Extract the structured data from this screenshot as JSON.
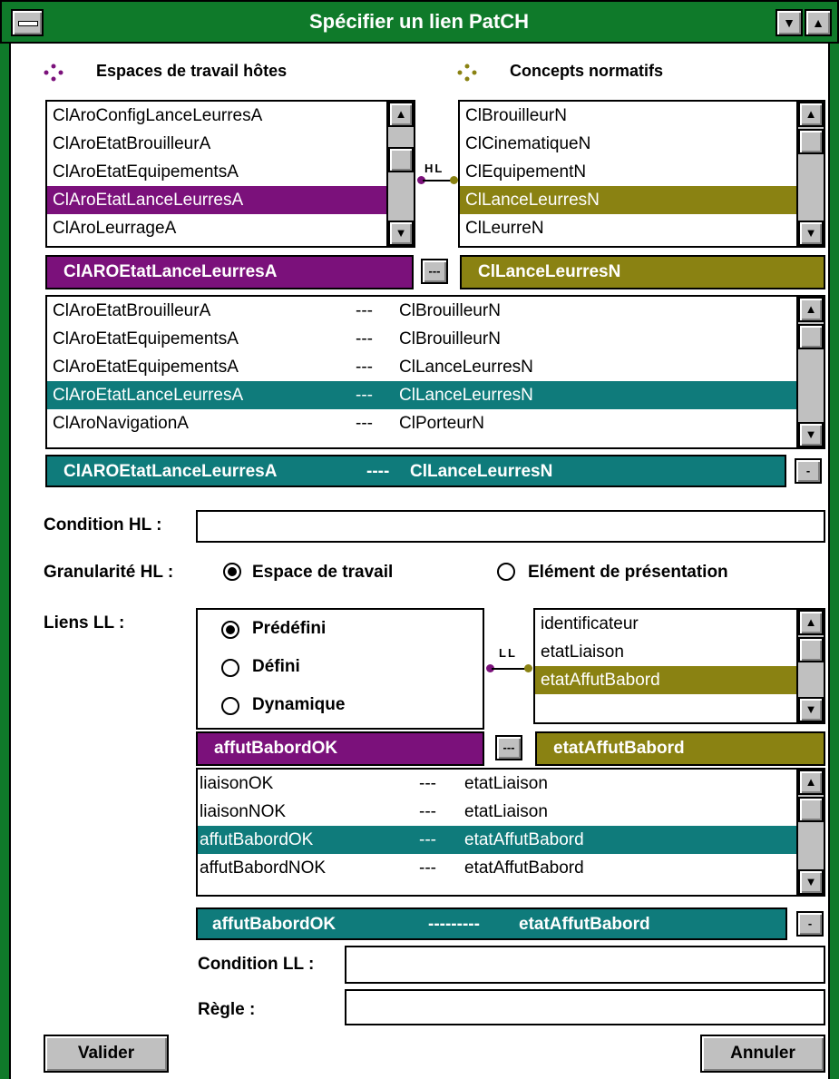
{
  "window": {
    "title": "Spécifier un lien PatCH"
  },
  "colors": {
    "purple": "#7b117b",
    "olive": "#8a8212",
    "teal": "#0f7b7b",
    "frame": "#0f7a2a"
  },
  "headers": {
    "host": "Espaces de travail hôtes",
    "normative": "Concepts normatifs"
  },
  "host_list": [
    "ClAroConfigLanceLeurresA",
    "ClAroEtatBrouilleurA",
    "ClAroEtatEquipementsA",
    "ClAroEtatLanceLeurresA",
    "ClAroLeurrageA"
  ],
  "normative_list": [
    "ClBrouilleurN",
    "ClCinematiqueN",
    "ClEquipementN",
    "ClLanceLeurresN",
    "ClLeurreN"
  ],
  "hl_tag": "HL",
  "ll_tag": "LL",
  "host_selected": "ClAROEtatLanceLeurresA",
  "normative_selected": "ClLanceLeurresN",
  "link_button": "---",
  "remove_button": "-",
  "hl_links": [
    [
      "ClAroEtatBrouilleurA",
      "---",
      "ClBrouilleurN"
    ],
    [
      "ClAroEtatEquipementsA",
      "---",
      "ClBrouilleurN"
    ],
    [
      "ClAroEtatEquipementsA",
      "---",
      "ClLanceLeurresN"
    ],
    [
      "ClAroEtatLanceLeurresA",
      "---",
      "ClLanceLeurresN"
    ],
    [
      "ClAroNavigationA",
      "---",
      "ClPorteurN"
    ]
  ],
  "hl_selected": {
    "left": "ClAROEtatLanceLeurresA",
    "sep": "----",
    "right": "ClLanceLeurresN"
  },
  "condition_hl": {
    "label": "Condition HL :",
    "value": ""
  },
  "granularite": {
    "label": "Granularité HL :",
    "opt1": "Espace de travail",
    "opt2": "Elément de présentation"
  },
  "liens_ll": {
    "label": "Liens LL :",
    "opt1": "Prédéfini",
    "opt2": "Défini",
    "opt3": "Dynamique"
  },
  "attr_list": [
    "identificateur",
    "etatLiaison",
    "etatAffutBabord"
  ],
  "ll_left_selected": "affutBabordOK",
  "ll_right_selected": "etatAffutBabord",
  "ll_links": [
    [
      "liaisonOK",
      "---",
      "etatLiaison"
    ],
    [
      "liaisonNOK",
      "---",
      "etatLiaison"
    ],
    [
      "affutBabordOK",
      "---",
      "etatAffutBabord"
    ],
    [
      "affutBabordNOK",
      "---",
      "etatAffutBabord"
    ]
  ],
  "ll_selected": {
    "left": "affutBabordOK",
    "sep": "---------",
    "right": "etatAffutBabord"
  },
  "condition_ll": {
    "label": "Condition LL :",
    "value": ""
  },
  "regle": {
    "label": "Règle :",
    "value": ""
  },
  "buttons": {
    "valider": "Valider",
    "annuler": "Annuler"
  }
}
